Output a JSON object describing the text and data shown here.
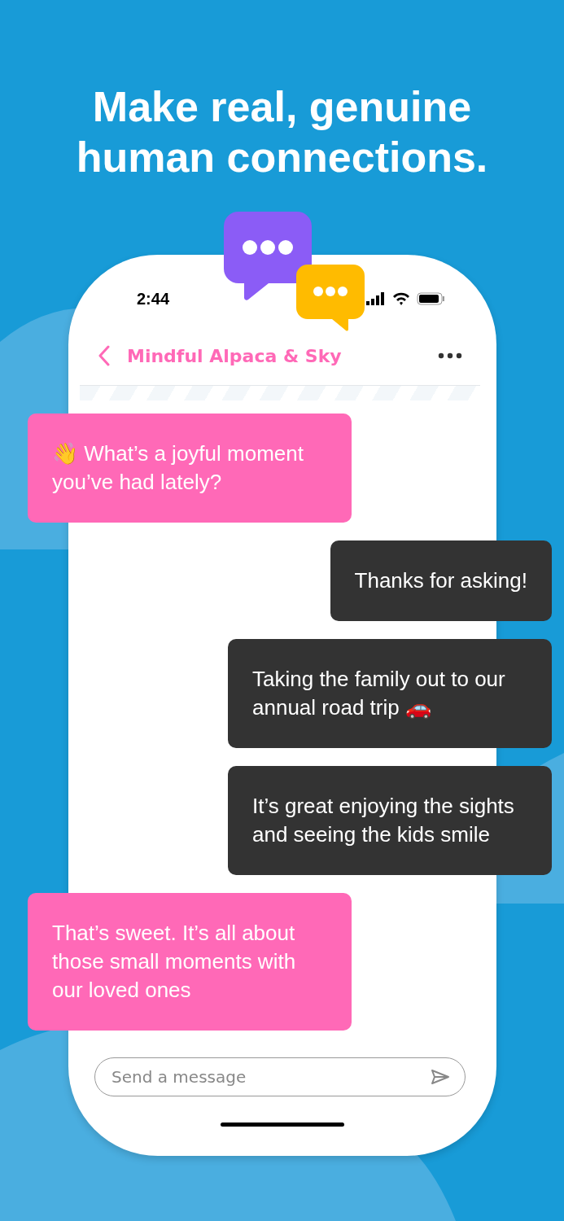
{
  "headline": "Make real, genuine human connections.",
  "status_bar": {
    "time": "2:44"
  },
  "chat_header": {
    "title": "Mindful Alpaca & Sky"
  },
  "messages": [
    {
      "kind": "received",
      "text": "👋 What’s a joyful moment you’ve had lately?"
    },
    {
      "kind": "sent",
      "text": "Thanks for asking!"
    },
    {
      "kind": "sent",
      "text": "Taking the family out to our annual road trip 🚗"
    },
    {
      "kind": "sent",
      "text": "It’s great enjoying the sights and seeing the kids smile"
    },
    {
      "kind": "received",
      "text": "That’s sweet. It’s all about those small moments with our loved ones"
    }
  ],
  "composer": {
    "placeholder": "Send a message"
  }
}
